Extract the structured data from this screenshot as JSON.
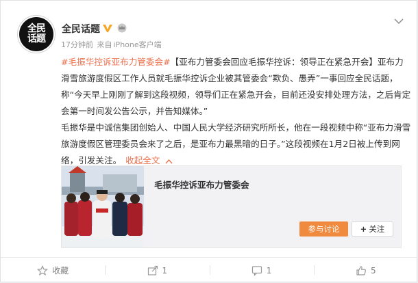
{
  "post": {
    "author": "全民话题",
    "avatar_text": [
      "全民",
      "话题"
    ],
    "verified_badge_icon": "verified-v-icon",
    "member_icon": "member-crown-icon",
    "time": "17分钟前",
    "source_prefix": "来自",
    "source": "iPhone客户端",
    "more_icon": "chevron-down-icon"
  },
  "content": {
    "hashtag": "#毛振华控诉亚布力管委会#",
    "headline": "【亚布力管委会回应毛振华控诉：领导正在紧急开会】",
    "body1": "亚布力滑雪旅游度假区工作人员就毛振华控诉企业被其管委会“欺负、愚弄”一事回应全民话题，称“今天早上刚刚了解到这段视频，领导们正在紧急开会，目前还没安排处理方法，之后肯定会第一时间发公告公示，并告知媒体。”",
    "body2": "毛振华是中诚信集团创始人、中国人民大学经济研究所所长，他在一段视频中称“亚布力滑雪旅游度假区管理委员会来了之后，是亚布力最黑暗的日子。”这段视频在1月2日被上传到网络，引发关注。",
    "collapse_label": "收起全文",
    "collapse_icon": "chevron-up-icon"
  },
  "topic_card": {
    "title": "毛振华控诉亚布力管委会",
    "discuss_button": "参与讨论",
    "follow_button": "关注",
    "follow_icon": "plus-icon"
  },
  "actions": [
    {
      "icon": "star-icon",
      "label": "收藏"
    },
    {
      "icon": "share-icon",
      "label": "1"
    },
    {
      "icon": "comment-icon",
      "label": "1"
    },
    {
      "icon": "thumbs-up-icon",
      "label": "5"
    }
  ],
  "colors": {
    "link": "#eb7350",
    "discuss_button": "#f08a3e",
    "verified": "#f5a623"
  }
}
